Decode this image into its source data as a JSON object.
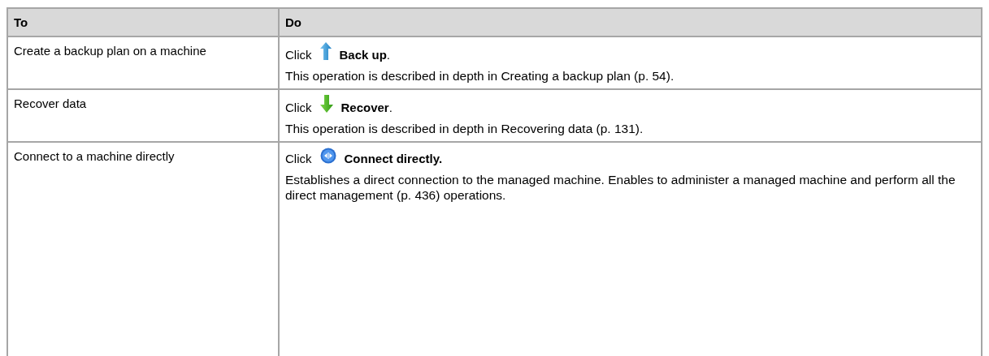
{
  "table": {
    "columns": [
      "To",
      "Do"
    ],
    "rows": [
      {
        "to": "Create a backup plan on a machine",
        "action": {
          "prefix": "Click",
          "kind": "up",
          "label": "**Back up**."
        },
        "paragraphs": [
          "This operation is described in depth in Creating a backup plan (p. 54)."
        ]
      },
      {
        "to": "Recover data",
        "action": {
          "prefix": "Click",
          "kind": "down",
          "label": "**Recover**."
        },
        "paragraphs": [
          "This operation is described in depth in Recovering data (p. 131)."
        ]
      },
      {
        "to": "Connect to a machine directly",
        "action": {
          "prefix": "Click",
          "kind": "connect",
          "label": "**Connect directly.**"
        },
        "paragraphs": [
          "Establishes a direct connection to the managed machine. Enables to administer a managed machine and perform all the direct management (p. 436) operations."
        ]
      }
    ]
  }
}
